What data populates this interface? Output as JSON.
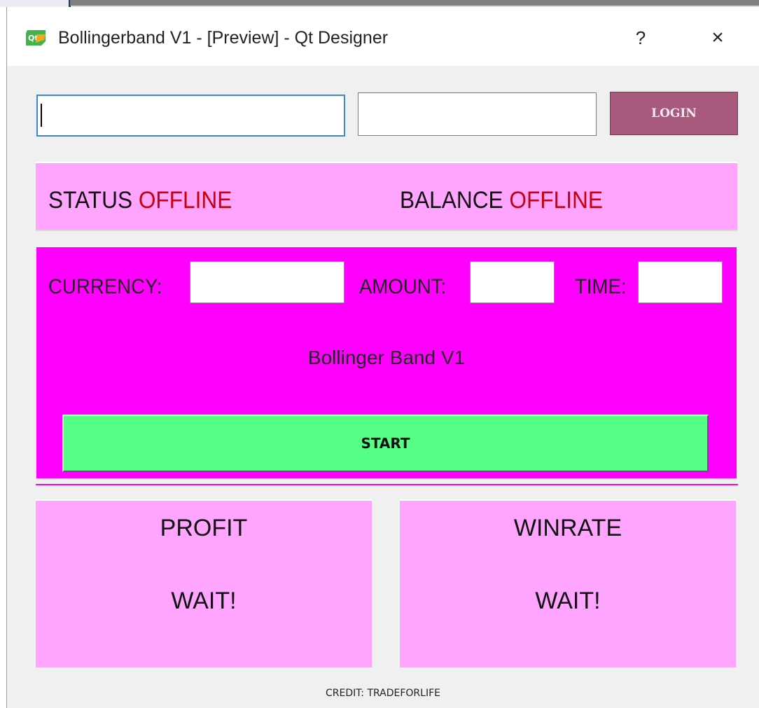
{
  "window": {
    "title": "Bollingerband V1 - [Preview] - Qt Designer",
    "help_label": "?",
    "close_label": "×"
  },
  "login": {
    "username_value": "",
    "password_value": "",
    "button_label": "LOGIN"
  },
  "status": {
    "status_label": "STATUS",
    "status_value": "OFFLINE",
    "balance_label": "BALANCE",
    "balance_value": "OFFLINE"
  },
  "controls": {
    "currency_label": "CURRENCY:",
    "amount_label": "AMOUNT:",
    "time_label": "TIME:",
    "currency_value": "",
    "amount_value": "",
    "time_value": "",
    "strategy_name": "Bollinger Band V1",
    "start_label": "START"
  },
  "stats": {
    "profit_label": "PROFIT",
    "profit_value": "WAIT!",
    "winrate_label": "WINRATE",
    "winrate_value": "WAIT!"
  },
  "footer": {
    "credit": "CREDIT: TRADEFORLIFE"
  },
  "colors": {
    "status_panel": "#ffa5ff",
    "control_panel": "#ff00ff",
    "start_button": "#55ff86",
    "login_button": "#a85a7d",
    "offline_text": "#c8000a"
  },
  "icons": {
    "app_icon": "qt-designer-icon",
    "help_icon": "question-mark",
    "close_icon": "x-mark"
  }
}
